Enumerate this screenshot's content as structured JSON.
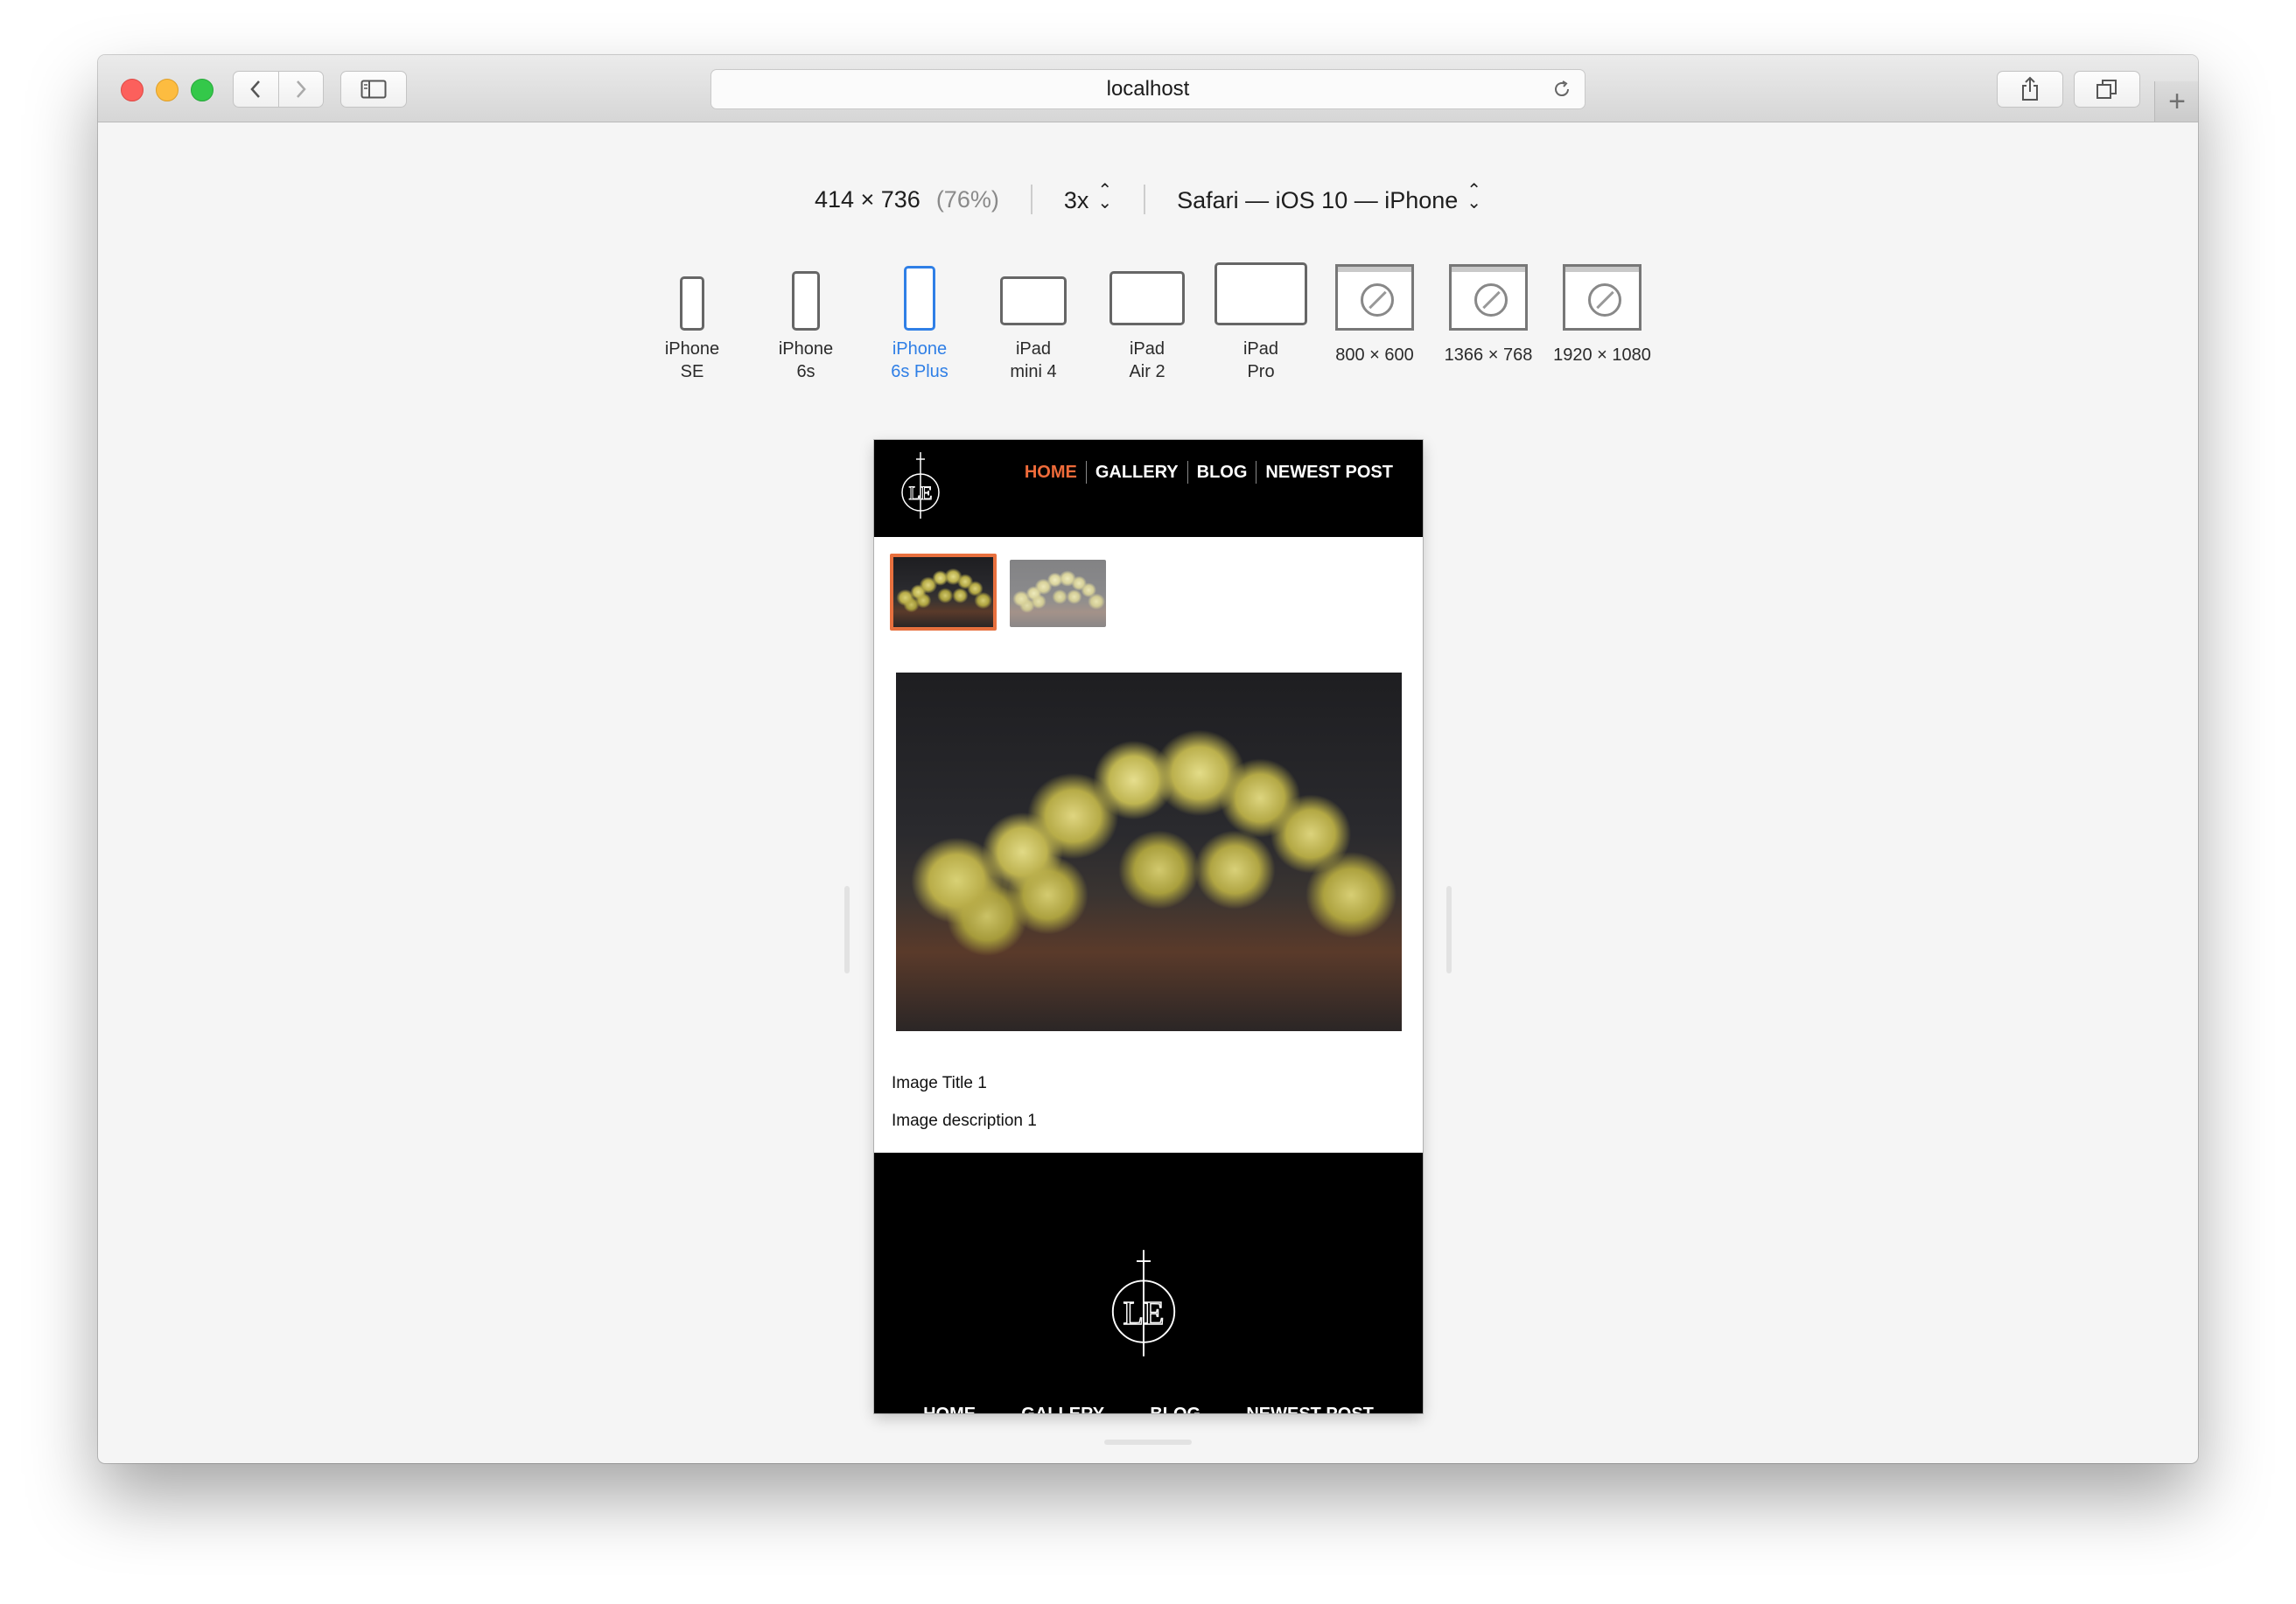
{
  "browser": {
    "address": "localhost"
  },
  "rdm": {
    "size": "414 × 736",
    "zoom": "(76%)",
    "scale": "3x",
    "user_agent": "Safari — iOS 10 — iPhone",
    "devices": [
      {
        "line1": "iPhone",
        "line2": "SE",
        "icon": "phone-icon",
        "active": false
      },
      {
        "line1": "iPhone",
        "line2": "6s",
        "icon": "phone-icon",
        "active": false
      },
      {
        "line1": "iPhone",
        "line2": "6s Plus",
        "icon": "phone-icon",
        "active": true
      },
      {
        "line1": "iPad",
        "line2": "mini 4",
        "icon": "tablet-icon",
        "active": false
      },
      {
        "line1": "iPad",
        "line2": "Air 2",
        "icon": "tablet-icon",
        "active": false
      },
      {
        "line1": "iPad",
        "line2": "Pro",
        "icon": "tablet-icon",
        "active": false
      },
      {
        "line1": "800 × 600",
        "line2": "",
        "icon": "safari-window-icon",
        "active": false
      },
      {
        "line1": "1366 × 768",
        "line2": "",
        "icon": "safari-window-icon",
        "active": false
      },
      {
        "line1": "1920 × 1080",
        "line2": "",
        "icon": "safari-window-icon",
        "active": false
      }
    ]
  },
  "site": {
    "nav": [
      "HOME",
      "GALLERY",
      "BLOG",
      "NEWEST POST"
    ],
    "active_nav": "HOME",
    "logo_text": "LE",
    "image_title": "Image Title 1",
    "image_description": "Image description 1",
    "footer_nav": [
      "HOME",
      "GALLERY",
      "BLOG",
      "NEWEST POST"
    ]
  },
  "colors": {
    "accent": "#ef6b3a",
    "active_device": "#2f7fe6"
  }
}
